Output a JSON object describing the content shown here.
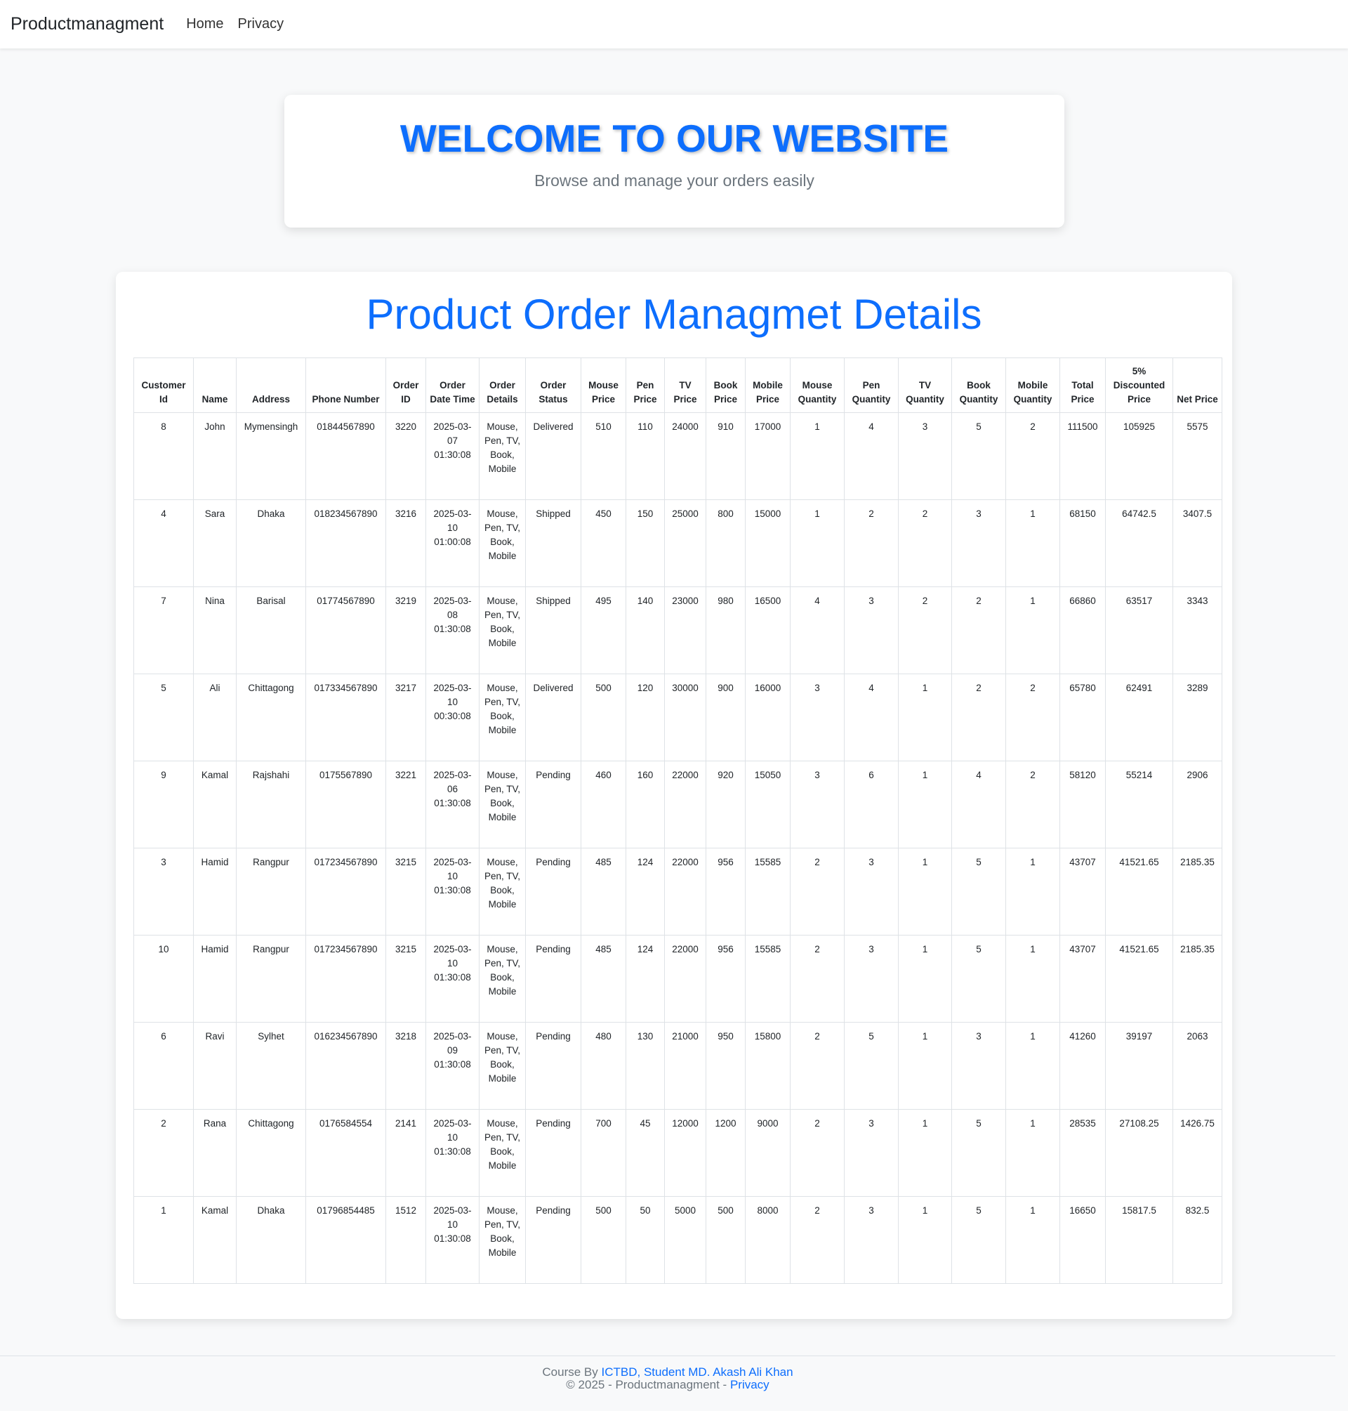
{
  "nav": {
    "brand": "Productmanagment",
    "links": [
      "Home",
      "Privacy"
    ]
  },
  "hero": {
    "title": "WELCOME TO OUR WEBSITE",
    "subtitle": "Browse and manage your orders easily"
  },
  "orders": {
    "title": "Product Order Managmet Details",
    "columns": [
      "Customer Id",
      "Name",
      "Address",
      "Phone Number",
      "Order ID",
      "Order Date Time",
      "Order Details",
      "Order Status",
      "Mouse Price",
      "Pen Price",
      "TV Price",
      "Book Price",
      "Mobile Price",
      "Mouse Quantity",
      "Pen Quantity",
      "TV Quantity",
      "Book Quantity",
      "Mobile Quantity",
      "Total Price",
      "5% Discounted Price",
      "Net Price"
    ],
    "rows": [
      [
        "8",
        "John",
        "Mymensingh",
        "01844567890",
        "3220",
        "2025-03-07 01:30:08",
        "Mouse, Pen, TV, Book, Mobile",
        "Delivered",
        "510",
        "110",
        "24000",
        "910",
        "17000",
        "1",
        "4",
        "3",
        "5",
        "2",
        "111500",
        "105925",
        "5575"
      ],
      [
        "4",
        "Sara",
        "Dhaka",
        "018234567890",
        "3216",
        "2025-03-10 01:00:08",
        "Mouse, Pen, TV, Book, Mobile",
        "Shipped",
        "450",
        "150",
        "25000",
        "800",
        "15000",
        "1",
        "2",
        "2",
        "3",
        "1",
        "68150",
        "64742.5",
        "3407.5"
      ],
      [
        "7",
        "Nina",
        "Barisal",
        "01774567890",
        "3219",
        "2025-03-08 01:30:08",
        "Mouse, Pen, TV, Book, Mobile",
        "Shipped",
        "495",
        "140",
        "23000",
        "980",
        "16500",
        "4",
        "3",
        "2",
        "2",
        "1",
        "66860",
        "63517",
        "3343"
      ],
      [
        "5",
        "Ali",
        "Chittagong",
        "017334567890",
        "3217",
        "2025-03-10 00:30:08",
        "Mouse, Pen, TV, Book, Mobile",
        "Delivered",
        "500",
        "120",
        "30000",
        "900",
        "16000",
        "3",
        "4",
        "1",
        "2",
        "2",
        "65780",
        "62491",
        "3289"
      ],
      [
        "9",
        "Kamal",
        "Rajshahi",
        "0175567890",
        "3221",
        "2025-03-06 01:30:08",
        "Mouse, Pen, TV, Book, Mobile",
        "Pending",
        "460",
        "160",
        "22000",
        "920",
        "15050",
        "3",
        "6",
        "1",
        "4",
        "2",
        "58120",
        "55214",
        "2906"
      ],
      [
        "3",
        "Hamid",
        "Rangpur",
        "017234567890",
        "3215",
        "2025-03-10 01:30:08",
        "Mouse, Pen, TV, Book, Mobile",
        "Pending",
        "485",
        "124",
        "22000",
        "956",
        "15585",
        "2",
        "3",
        "1",
        "5",
        "1",
        "43707",
        "41521.65",
        "2185.35"
      ],
      [
        "10",
        "Hamid",
        "Rangpur",
        "017234567890",
        "3215",
        "2025-03-10 01:30:08",
        "Mouse, Pen, TV, Book, Mobile",
        "Pending",
        "485",
        "124",
        "22000",
        "956",
        "15585",
        "2",
        "3",
        "1",
        "5",
        "1",
        "43707",
        "41521.65",
        "2185.35"
      ],
      [
        "6",
        "Ravi",
        "Sylhet",
        "016234567890",
        "3218",
        "2025-03-09 01:30:08",
        "Mouse, Pen, TV, Book, Mobile",
        "Pending",
        "480",
        "130",
        "21000",
        "950",
        "15800",
        "2",
        "5",
        "1",
        "3",
        "1",
        "41260",
        "39197",
        "2063"
      ],
      [
        "2",
        "Rana",
        "Chittagong",
        "0176584554",
        "2141",
        "2025-03-10 01:30:08",
        "Mouse, Pen, TV, Book, Mobile",
        "Pending",
        "700",
        "45",
        "12000",
        "1200",
        "9000",
        "2",
        "3",
        "1",
        "5",
        "1",
        "28535",
        "27108.25",
        "1426.75"
      ],
      [
        "1",
        "Kamal",
        "Dhaka",
        "01796854485",
        "1512",
        "2025-03-10 01:30:08",
        "Mouse, Pen, TV, Book, Mobile",
        "Pending",
        "500",
        "50",
        "5000",
        "500",
        "8000",
        "2",
        "3",
        "1",
        "5",
        "1",
        "16650",
        "15817.5",
        "832.5"
      ]
    ]
  },
  "footer": {
    "course_prefix": "Course By ",
    "course_link": "ICTBD, Student MD. Akash Ali Khan",
    "copyright": "© 2025 - Productmanagment - ",
    "privacy_link": "Privacy"
  }
}
